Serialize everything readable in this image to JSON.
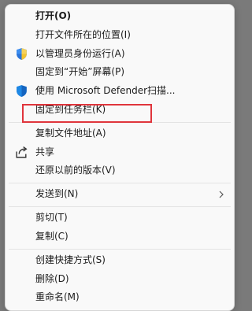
{
  "context_menu": {
    "items": [
      {
        "label": "打开(O)"
      },
      {
        "label": "打开文件所在的位置(I)"
      },
      {
        "label": "以管理员身份运行(A)",
        "icon": "uac-shield-icon"
      },
      {
        "label": "固定到“开始”屏幕(P)"
      },
      {
        "label": "使用 Microsoft Defender扫描...",
        "icon": "defender-shield-icon"
      },
      {
        "label": "固定到任务栏(K)"
      },
      {
        "label": "复制文件地址(A)"
      },
      {
        "label": "共享",
        "icon": "share-icon"
      },
      {
        "label": "还原以前的版本(V)"
      },
      {
        "label": "发送到(N)",
        "icon": "chevron-right-icon"
      },
      {
        "label": "剪切(T)"
      },
      {
        "label": "复制(C)"
      },
      {
        "label": "创建快捷方式(S)"
      },
      {
        "label": "删除(D)"
      },
      {
        "label": "重命名(M)"
      }
    ]
  },
  "highlight_color": "#e0353c"
}
